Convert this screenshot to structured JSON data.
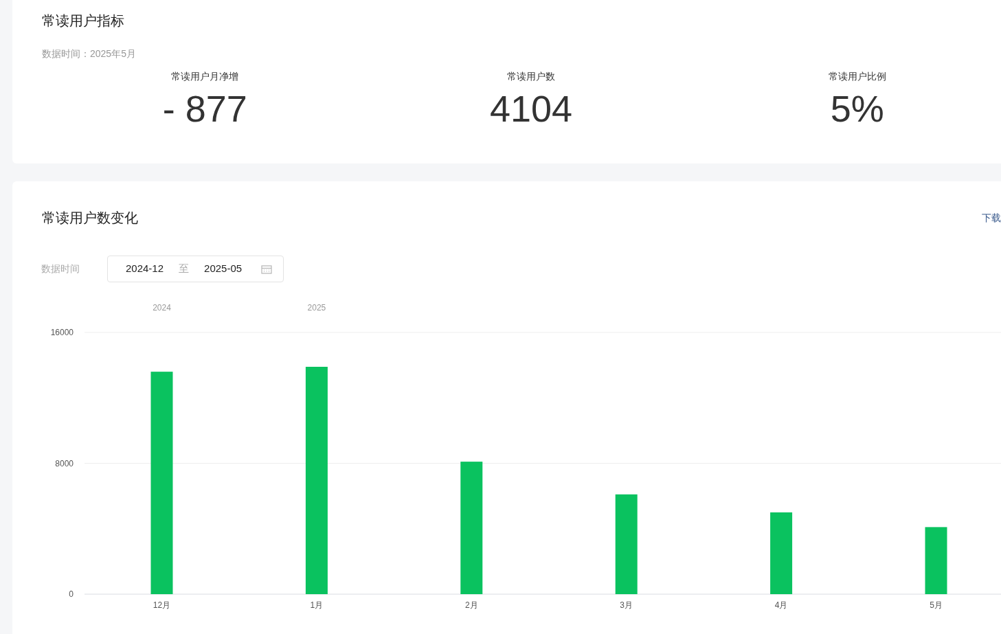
{
  "summary": {
    "title": "常读用户指标",
    "data_time": "数据时间：2025年5月",
    "metrics": [
      {
        "label": "常读用户月净增",
        "value": "- 877"
      },
      {
        "label": "常读用户数",
        "value": "4104"
      },
      {
        "label": "常读用户比例",
        "value": "5%"
      }
    ]
  },
  "trend": {
    "title": "常读用户数变化",
    "download": "下载",
    "date_range": {
      "label": "数据时间",
      "start": "2024-12",
      "separator": "至",
      "end": "2025-05"
    },
    "chart_data": {
      "type": "bar",
      "categories": [
        "12月",
        "1月",
        "2月",
        "3月",
        "4月",
        "5月"
      ],
      "series": [
        {
          "color": "#0ac25f",
          "values": [
            13600,
            13900,
            8100,
            6100,
            5000,
            4100
          ]
        }
      ],
      "ylim": [
        0,
        16000
      ],
      "yticks": [
        0,
        8000,
        16000
      ],
      "annotations": [
        "2024",
        "2025"
      ]
    }
  }
}
